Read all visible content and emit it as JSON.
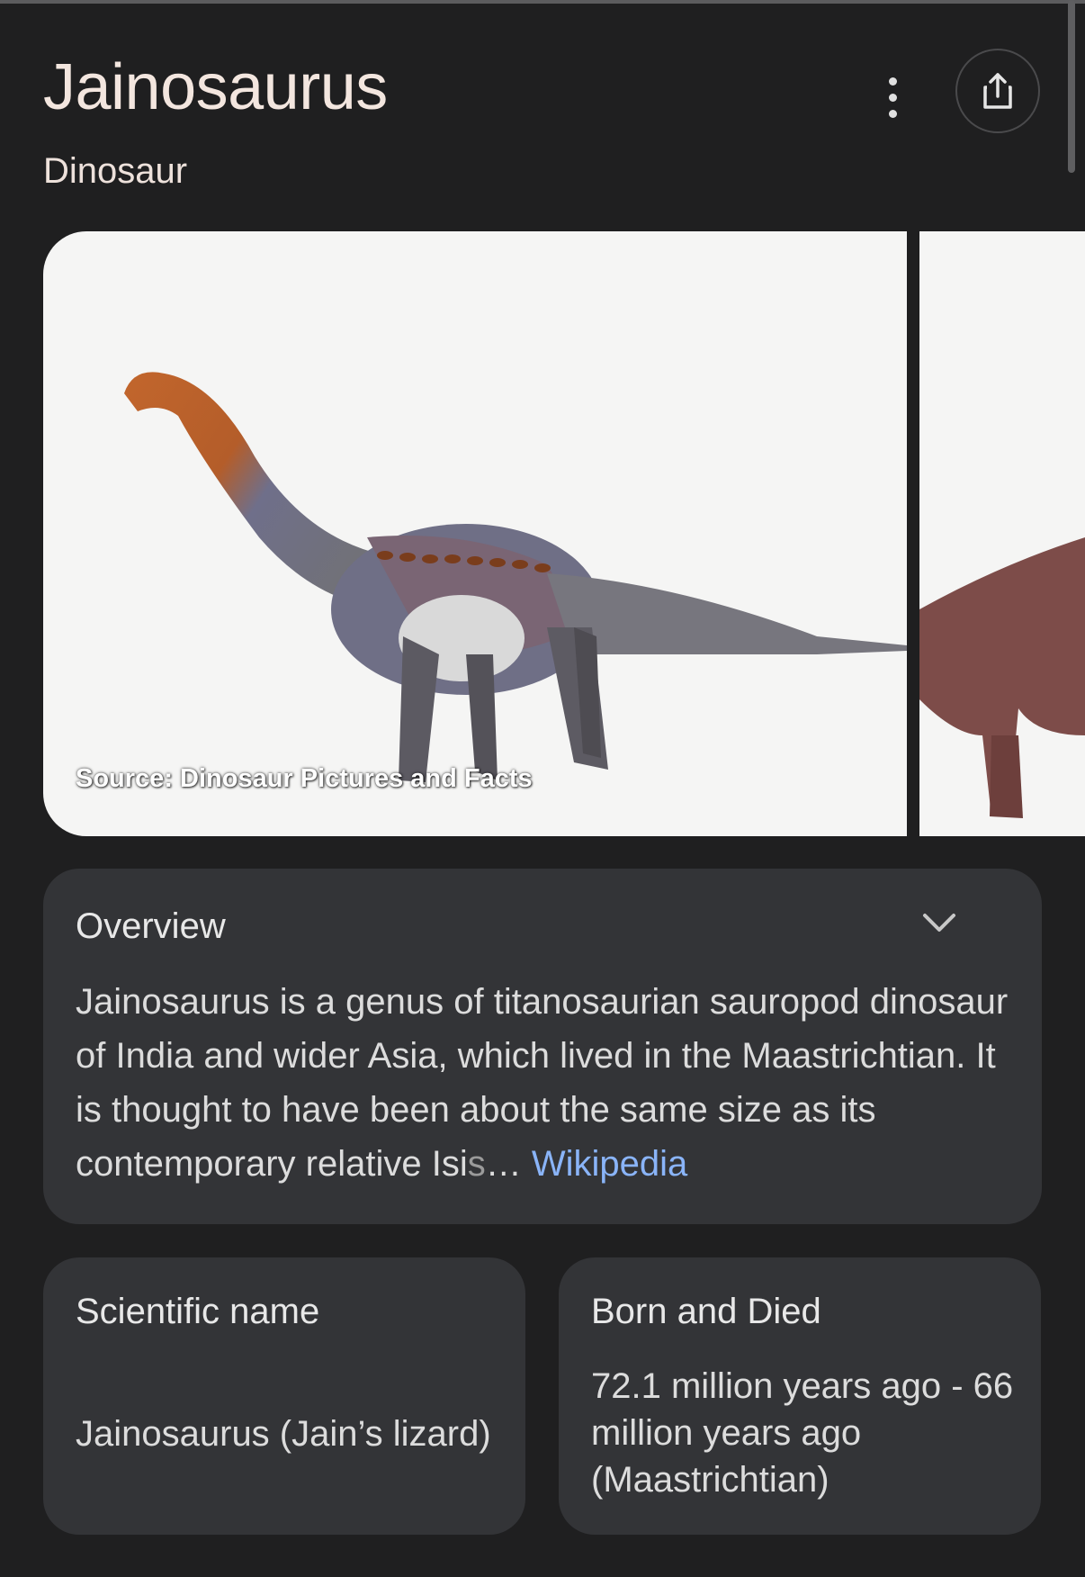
{
  "header": {
    "title": "Jainosaurus",
    "subtitle": "Dinosaur"
  },
  "images": {
    "primary_source": "Source: Dinosaur Pictures and Facts"
  },
  "overview": {
    "title": "Overview",
    "text_main": "Jainosaurus is a genus of titanosaurian sauropod dinosaur of India and wider Asia, which lived in the Maastrichtian. It is thought to have been about the same size as its contemporary relative Isi",
    "text_faded": "s",
    "ellipsis": "… ",
    "link": "Wikipedia"
  },
  "facts": [
    {
      "label": "Scientific name",
      "value": "Jainosaurus (Jain’s lizard)"
    },
    {
      "label": "Born and Died",
      "value": "72.1 million years ago - 66 million years ago (Maastrichtian)"
    }
  ],
  "colors": {
    "background": "#1f1f20",
    "card": "#333437",
    "link": "#8ab4f8",
    "title": "#f3e6df"
  },
  "icons": [
    "more-vert-icon",
    "share-icon",
    "chevron-down-icon"
  ]
}
